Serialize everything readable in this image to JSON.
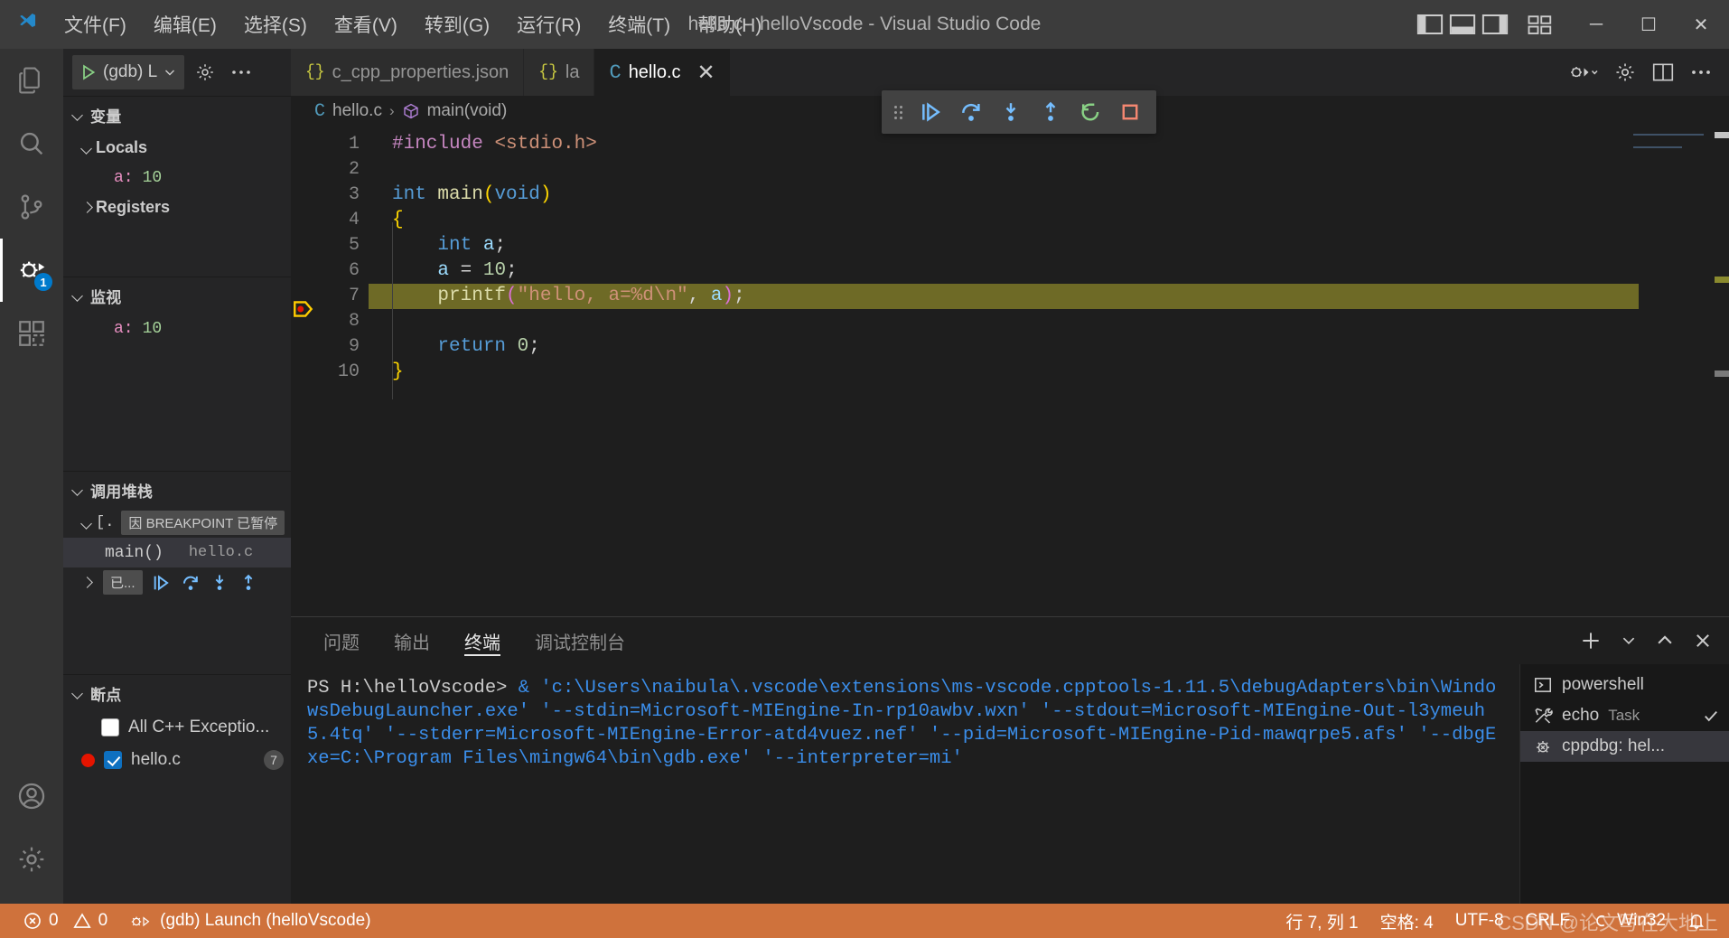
{
  "titlebar": {
    "menus": [
      "文件(F)",
      "编辑(E)",
      "选择(S)",
      "查看(V)",
      "转到(G)",
      "运行(R)",
      "终端(T)",
      "帮助(H)"
    ],
    "window_title": "hello.c - helloVscode - Visual Studio Code",
    "minimize": "─",
    "maximize": "☐",
    "close": "✕"
  },
  "activitybar": {
    "items": [
      {
        "name": "explorer",
        "icon": "files-icon"
      },
      {
        "name": "search",
        "icon": "search-icon"
      },
      {
        "name": "source-control",
        "icon": "source-control-icon"
      },
      {
        "name": "run-and-debug",
        "icon": "run-debug-icon",
        "badge": "1",
        "active": true
      },
      {
        "name": "extensions",
        "icon": "extensions-icon"
      }
    ],
    "bottom": [
      {
        "name": "accounts",
        "icon": "account-icon"
      },
      {
        "name": "settings",
        "icon": "gear-icon"
      }
    ]
  },
  "sidebar": {
    "launch_config": "(gdb) L",
    "gear_title": "打开“launch.json”",
    "more_title": "视图和更多操作...",
    "variables": {
      "title": "变量",
      "groups": [
        {
          "label": "Locals",
          "expanded": true,
          "items": [
            {
              "name": "a:",
              "value": "10"
            }
          ]
        },
        {
          "label": "Registers",
          "expanded": false,
          "items": []
        }
      ]
    },
    "watch": {
      "title": "监视",
      "items": [
        {
          "name": "a:",
          "value": "10"
        }
      ]
    },
    "callstack": {
      "title": "调用堆栈",
      "thread_label": "[.",
      "pause_reason": "因 BREAKPOINT 已暂停",
      "frames": [
        {
          "fn": "main()",
          "file": "hello.c"
        }
      ],
      "second_thread_label": "已..."
    },
    "breakpoints": {
      "title": "断点",
      "items": [
        {
          "label": "All C++ Exceptio...",
          "checked": false,
          "dot": false,
          "count": ""
        },
        {
          "label": "hello.c",
          "checked": true,
          "dot": true,
          "count": "7"
        }
      ]
    }
  },
  "tabs": [
    {
      "label": "c_cpp_properties.json",
      "icon": "json-icon",
      "active": false
    },
    {
      "label": "la",
      "icon": "json-icon",
      "active": false
    },
    {
      "label": "hello.c",
      "icon": "c-icon",
      "active": true,
      "closable": true
    }
  ],
  "debug_toolbar": {
    "buttons": [
      {
        "name": "continue",
        "title": "继续"
      },
      {
        "name": "step-over",
        "title": "单步跳过"
      },
      {
        "name": "step-into",
        "title": "单步调试"
      },
      {
        "name": "step-out",
        "title": "单步跳出"
      },
      {
        "name": "restart",
        "title": "重启"
      },
      {
        "name": "stop",
        "title": "停止"
      }
    ]
  },
  "breadcrumb": {
    "file": "hello.c",
    "symbol": "main(void)",
    "separator": "›"
  },
  "editor": {
    "filename": "hello.c",
    "lines": [
      {
        "n": "1",
        "tokens": [
          {
            "t": "#include",
            "c": "t-pre"
          },
          {
            "t": " ",
            "c": "t-plain"
          },
          {
            "t": "<stdio.h>",
            "c": "t-str"
          }
        ]
      },
      {
        "n": "2",
        "tokens": []
      },
      {
        "n": "3",
        "tokens": [
          {
            "t": "int",
            "c": "t-kw"
          },
          {
            "t": " ",
            "c": "t-plain"
          },
          {
            "t": "main",
            "c": "t-fn"
          },
          {
            "t": "(",
            "c": "t-p1"
          },
          {
            "t": "void",
            "c": "t-kw"
          },
          {
            "t": ")",
            "c": "t-p1"
          }
        ]
      },
      {
        "n": "4",
        "tokens": [
          {
            "t": "{",
            "c": "t-p1"
          }
        ]
      },
      {
        "n": "5",
        "tokens": [
          {
            "t": "    ",
            "c": "t-plain"
          },
          {
            "t": "int",
            "c": "t-kw"
          },
          {
            "t": " ",
            "c": "t-plain"
          },
          {
            "t": "a",
            "c": "t-var"
          },
          {
            "t": ";",
            "c": "t-plain"
          }
        ]
      },
      {
        "n": "6",
        "tokens": [
          {
            "t": "    ",
            "c": "t-plain"
          },
          {
            "t": "a",
            "c": "t-var"
          },
          {
            "t": " = ",
            "c": "t-plain"
          },
          {
            "t": "10",
            "c": "t-num"
          },
          {
            "t": ";",
            "c": "t-plain"
          }
        ]
      },
      {
        "n": "7",
        "highlight": true,
        "breakpoint": true,
        "current": true,
        "tokens": [
          {
            "t": "    ",
            "c": "t-plain"
          },
          {
            "t": "printf",
            "c": "t-fn"
          },
          {
            "t": "(",
            "c": "t-p2"
          },
          {
            "t": "\"hello, a=%d\\n\"",
            "c": "t-str"
          },
          {
            "t": ", ",
            "c": "t-plain"
          },
          {
            "t": "a",
            "c": "t-var"
          },
          {
            "t": ")",
            "c": "t-p2"
          },
          {
            "t": ";",
            "c": "t-plain"
          }
        ]
      },
      {
        "n": "8",
        "tokens": []
      },
      {
        "n": "9",
        "tokens": [
          {
            "t": "    ",
            "c": "t-plain"
          },
          {
            "t": "return",
            "c": "t-kw"
          },
          {
            "t": " ",
            "c": "t-plain"
          },
          {
            "t": "0",
            "c": "t-num"
          },
          {
            "t": ";",
            "c": "t-plain"
          }
        ]
      },
      {
        "n": "10",
        "tokens": [
          {
            "t": "}",
            "c": "t-p1"
          }
        ]
      }
    ]
  },
  "panel": {
    "tabs": [
      {
        "label": "问题",
        "active": false
      },
      {
        "label": "输出",
        "active": false
      },
      {
        "label": "终端",
        "active": true
      },
      {
        "label": "调试控制台",
        "active": false
      }
    ],
    "actions": [
      "new-terminal-icon",
      "chevron-down-icon",
      "chevron-up-icon",
      "close-icon"
    ],
    "terminal_prompt": "PS H:\\helloVscode> ",
    "terminal_command": "& 'c:\\Users\\naibula\\.vscode\\extensions\\ms-vscode.cpptools-1.11.5\\debugAdapters\\bin\\WindowsDebugLauncher.exe' '--stdin=Microsoft-MIEngine-In-rp10awbv.wxn' '--stdout=Microsoft-MIEngine-Out-l3ymeuh5.4tq' '--stderr=Microsoft-MIEngine-Error-atd4vuez.nef' '--pid=Microsoft-MIEngine-Pid-mawqrpe5.afs' '--dbgExe=C:\\Program Files\\mingw64\\bin\\gdb.exe' '--interpreter=mi'",
    "terminals": [
      {
        "label": "powershell",
        "sub": "",
        "icon": "terminal-icon",
        "selected": false,
        "check": false
      },
      {
        "label": "echo",
        "sub": "Task",
        "icon": "tools-icon",
        "selected": false,
        "check": true
      },
      {
        "label": "cppdbg: hel...",
        "sub": "",
        "icon": "debug-icon",
        "selected": true,
        "check": false
      }
    ]
  },
  "statusbar": {
    "errors": "0",
    "warnings": "0",
    "debug_config": "(gdb) Launch (helloVscode)",
    "cursor": "行 7, 列 1",
    "indent": "空格: 4",
    "encoding": "UTF-8",
    "eol": "CRLF",
    "language": "Win32",
    "bell": "🔔",
    "watermark": "CSDN @论文写在大地上"
  },
  "colors": {
    "statusbar_debug": "#cf723c",
    "accent_blue": "#007acc",
    "breakpoint_red": "#e51400",
    "highlight_line": "#6e6a26"
  }
}
